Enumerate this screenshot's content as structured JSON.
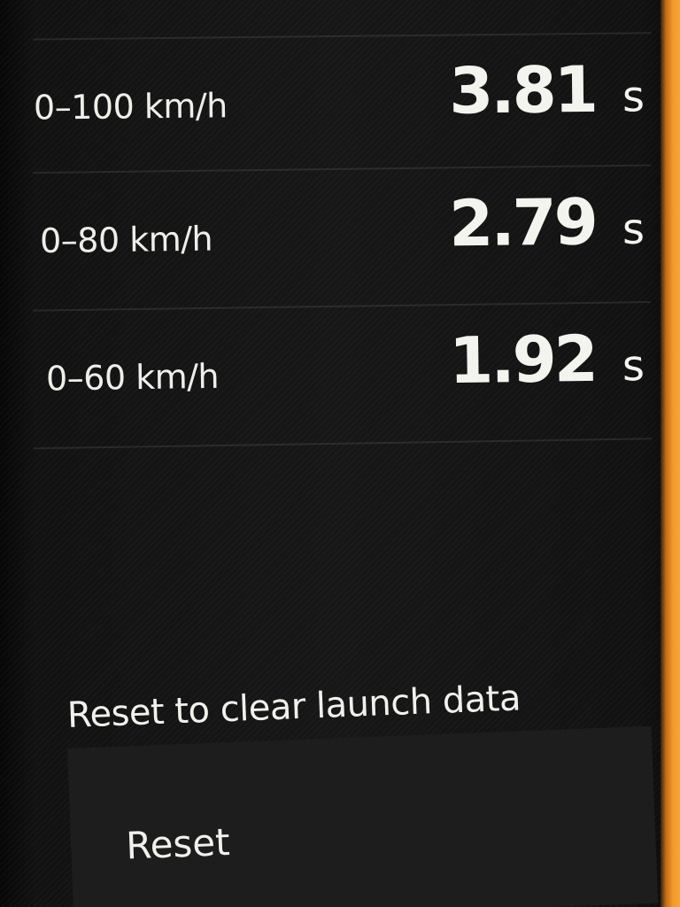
{
  "launch_times": [
    {
      "label": "0–100 km/h",
      "value": "3.81",
      "unit": "s"
    },
    {
      "label": "0–80 km/h",
      "value": "2.79",
      "unit": "s"
    },
    {
      "label": "0–60 km/h",
      "value": "1.92",
      "unit": "s"
    }
  ],
  "reset": {
    "caption": "Reset to clear launch data",
    "button_label": "Reset"
  },
  "colors": {
    "background": "#141414",
    "text": "#f2f2ee",
    "button_background": "#1d1d1d",
    "edge_accent": "#f2992a"
  }
}
